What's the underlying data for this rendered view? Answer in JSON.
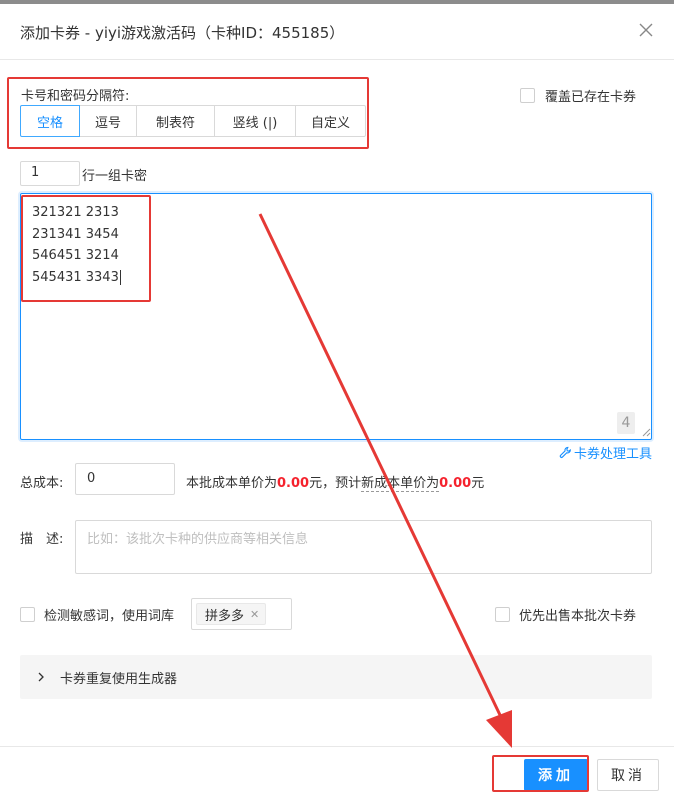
{
  "dialog": {
    "title": "添加卡券 - yiyi游戏激活码（卡种ID：455185）"
  },
  "separator": {
    "label": "卡号和密码分隔符:",
    "options": [
      "空格",
      "逗号",
      "制表符",
      "竖线 (|)",
      "自定义"
    ],
    "active_index": 0
  },
  "overwrite": {
    "label": "覆盖已存在卡券",
    "checked": false
  },
  "rows_per_group": {
    "value": "1",
    "label": "行一组卡密"
  },
  "cards_textarea": {
    "lines": [
      "321321 2313",
      "231341 3454",
      "546451 3214",
      "545431 3343"
    ],
    "count": "4"
  },
  "tool_link": {
    "icon": "wrench-icon",
    "label": "卡券处理工具"
  },
  "cost": {
    "label": "总成本:",
    "value": "0",
    "info_prefix": "本批成本单价为",
    "unit_price": "0.00",
    "info_mid": "元，预计",
    "info_dashed": "新成本单价为",
    "new_unit_price": "0.00",
    "info_suffix": "元"
  },
  "description": {
    "label": "描　述:",
    "placeholder": "比如：该批次卡种的供应商等相关信息"
  },
  "sensitive": {
    "label": "检测敏感词，使用词库",
    "checked": false,
    "tag": "拼多多"
  },
  "priority": {
    "label": "优先出售本批次卡券",
    "checked": false
  },
  "collapse": {
    "label": "卡券重复使用生成器"
  },
  "footer": {
    "add_label": "添加",
    "cancel_label": "取消"
  },
  "colors": {
    "primary": "#1890ff",
    "highlight": "#f5222d",
    "annotation": "#e53935"
  }
}
